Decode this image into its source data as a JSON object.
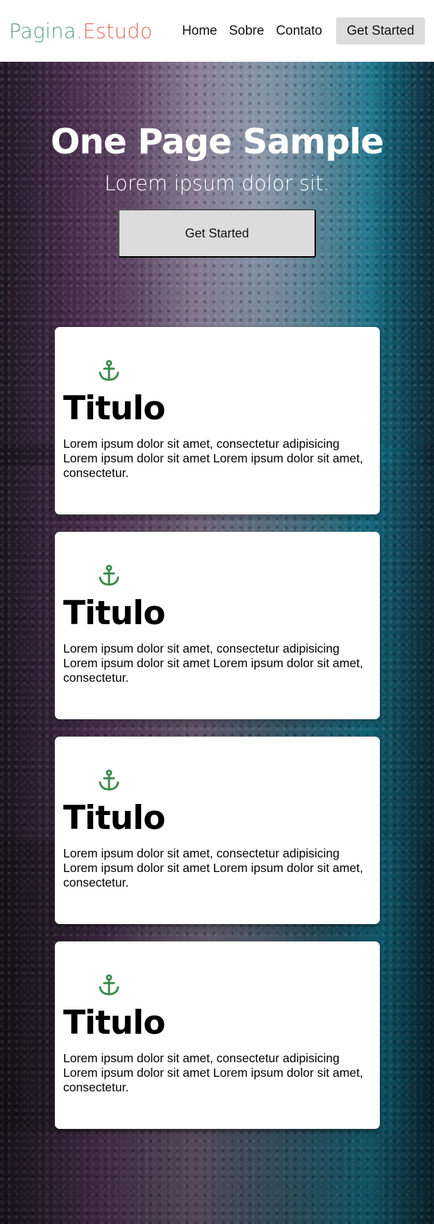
{
  "brand": {
    "part1": "Pagina.",
    "part2": "Estudo"
  },
  "nav": {
    "links": [
      "Home",
      "Sobre",
      "Contato"
    ],
    "cta": "Get Started"
  },
  "hero": {
    "title": "One Page Sample",
    "subtitle": "Lorem ipsum dolor sit.",
    "button": "Get Started"
  },
  "cards": [
    {
      "icon": "anchor-icon",
      "title": "Titulo",
      "text": "Lorem ipsum dolor sit amet, consectetur adipisicing Lorem ipsum dolor sit amet Lorem ipsum dolor sit amet, consectetur."
    },
    {
      "icon": "anchor-icon",
      "title": "Titulo",
      "text": "Lorem ipsum dolor sit amet, consectetur adipisicing Lorem ipsum dolor sit amet Lorem ipsum dolor sit amet, consectetur."
    },
    {
      "icon": "anchor-icon",
      "title": "Titulo",
      "text": "Lorem ipsum dolor sit amet, consectetur adipisicing Lorem ipsum dolor sit amet Lorem ipsum dolor sit amet, consectetur."
    },
    {
      "icon": "anchor-icon",
      "title": "Titulo",
      "text": "Lorem ipsum dolor sit amet, consectetur adipisicing Lorem ipsum dolor sit amet Lorem ipsum dolor sit amet, consectetur."
    }
  ],
  "colors": {
    "brand_green": "#5c9e7e",
    "brand_red": "#e06b5c",
    "icon_green": "#3a8a4a",
    "button_gray": "#dcdcdc"
  }
}
